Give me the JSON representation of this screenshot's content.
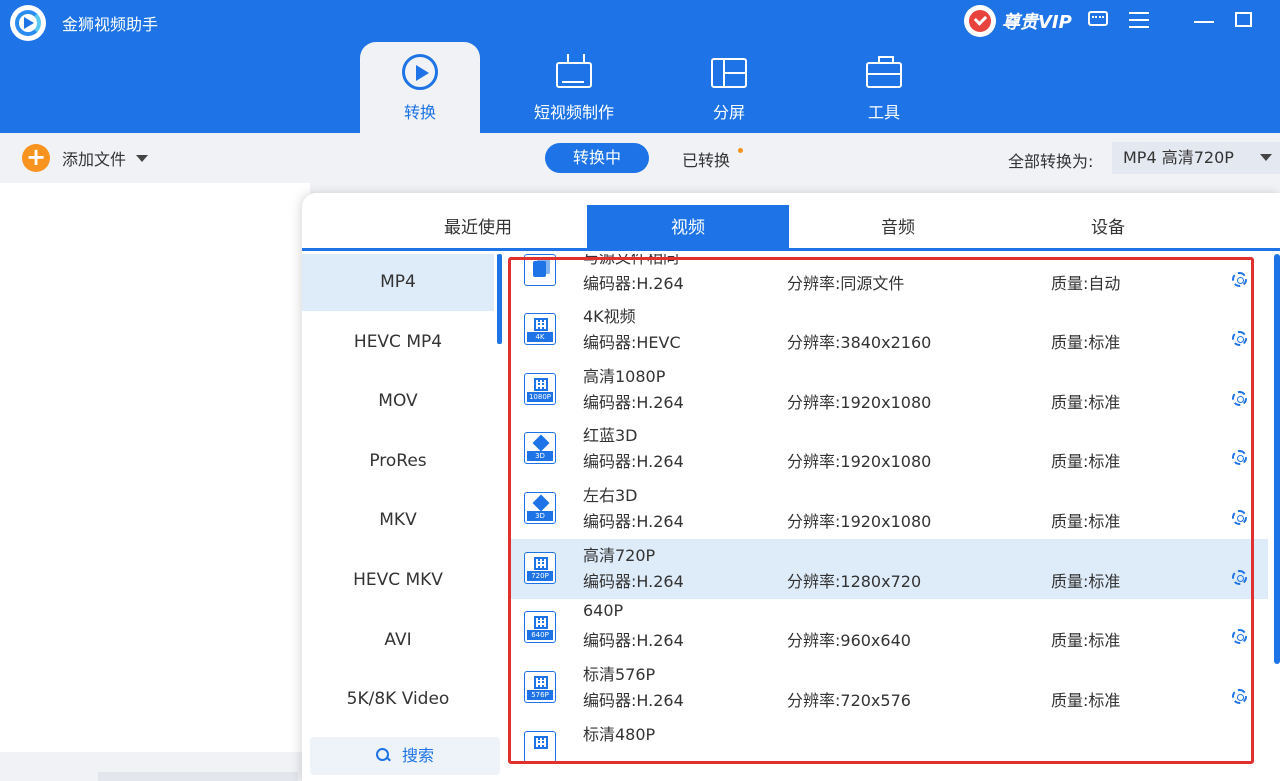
{
  "app": {
    "title": "金狮视频助手",
    "vip_label": "尊贵VIP"
  },
  "nav": {
    "tabs": [
      {
        "label": "转换",
        "icon": "convert-icon",
        "active": true
      },
      {
        "label": "短视频制作",
        "icon": "tv-icon",
        "active": false
      },
      {
        "label": "分屏",
        "icon": "split-screen-icon",
        "active": false
      },
      {
        "label": "工具",
        "icon": "toolbox-icon",
        "active": false
      }
    ]
  },
  "toolbar": {
    "add_file_label": "添加文件",
    "segment_converting": "转换中",
    "segment_converted": "已转换",
    "convert_all_label": "全部转换为:",
    "convert_all_value": "MP4 高清720P"
  },
  "panel": {
    "tabs": [
      "最近使用",
      "视频",
      "音频",
      "设备"
    ],
    "active_tab": "视频",
    "categories": [
      "MP4",
      "HEVC MP4",
      "MOV",
      "ProRes",
      "MKV",
      "HEVC MKV",
      "AVI",
      "5K/8K Video"
    ],
    "active_category": "MP4",
    "search_label": "搜索",
    "presets": [
      {
        "name": "与源文件相同",
        "codec": "编码器:H.264",
        "resolution": "分辨率:同源文件",
        "quality": "质量:自动",
        "tag": ""
      },
      {
        "name": "4K视频",
        "codec": "编码器:HEVC",
        "resolution": "分辨率:3840x2160",
        "quality": "质量:标准",
        "tag": "4K"
      },
      {
        "name": "高清1080P",
        "codec": "编码器:H.264",
        "resolution": "分辨率:1920x1080",
        "quality": "质量:标准",
        "tag": "1080P"
      },
      {
        "name": "红蓝3D",
        "codec": "编码器:H.264",
        "resolution": "分辨率:1920x1080",
        "quality": "质量:标准",
        "tag": "3D"
      },
      {
        "name": "左右3D",
        "codec": "编码器:H.264",
        "resolution": "分辨率:1920x1080",
        "quality": "质量:标准",
        "tag": "3D"
      },
      {
        "name": "高清720P",
        "codec": "编码器:H.264",
        "resolution": "分辨率:1280x720",
        "quality": "质量:标准",
        "tag": "720P"
      },
      {
        "name": "640P",
        "codec": "编码器:H.264",
        "resolution": "分辨率:960x640",
        "quality": "质量:标准",
        "tag": "640P"
      },
      {
        "name": "标清576P",
        "codec": "编码器:H.264",
        "resolution": "分辨率:720x576",
        "quality": "质量:标准",
        "tag": "576P"
      },
      {
        "name": "标清480P",
        "codec": "",
        "resolution": "",
        "quality": "",
        "tag": ""
      }
    ],
    "selected_preset": "高清720P"
  },
  "colors": {
    "brand_blue": "#1e74e6",
    "accent_orange": "#f7931e",
    "highlight_red": "#e0302f"
  }
}
